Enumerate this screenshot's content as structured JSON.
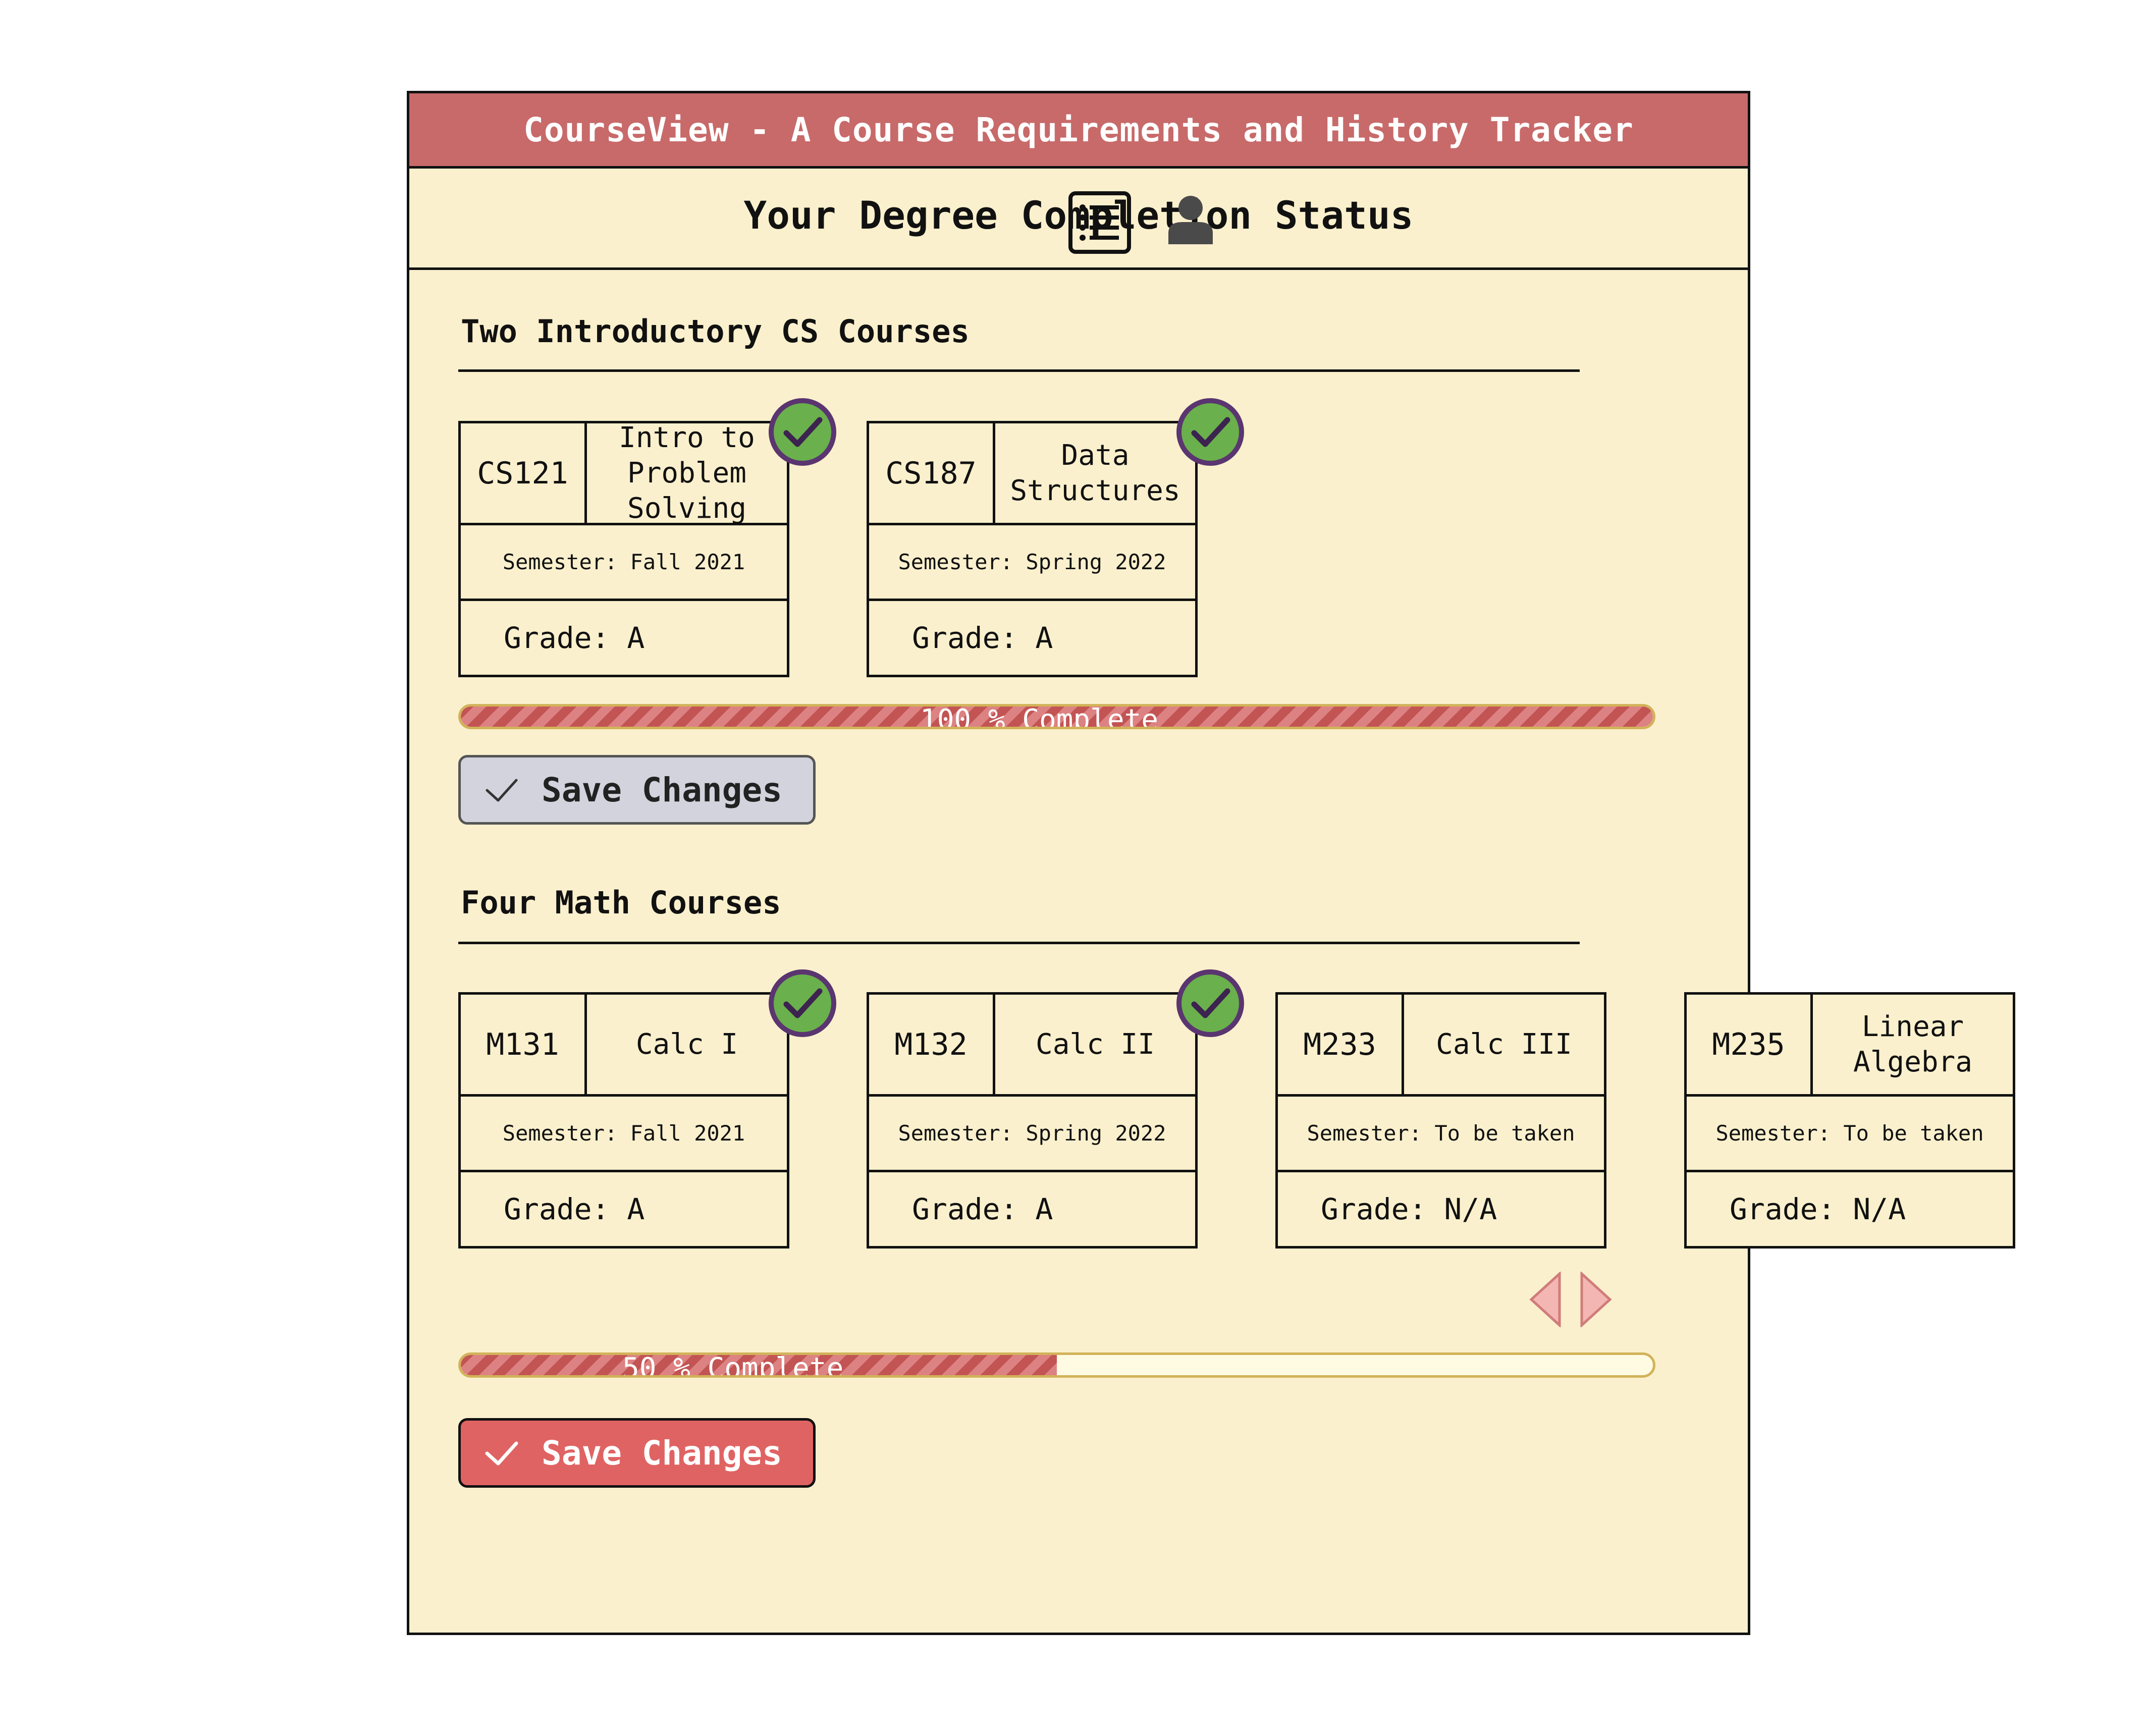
{
  "app": {
    "title": "CourseView - A Course Requirements and History Tracker"
  },
  "header": {
    "page_title": "Your Degree Completion Status"
  },
  "sections": [
    {
      "title": "Two Introductory CS Courses",
      "courses": [
        {
          "code": "CS121",
          "name": "Intro to Problem Solving",
          "semester": "Semester: Fall 2021",
          "grade": "Grade: A",
          "completed": true
        },
        {
          "code": "CS187",
          "name": "Data Structures",
          "semester": "Semester: Spring 2022",
          "grade": "Grade: A",
          "completed": true
        }
      ],
      "progress": {
        "value": 1.0,
        "label": "100 % Complete"
      },
      "save_label": "Save Changes"
    },
    {
      "title": "Four Math Courses",
      "courses": [
        {
          "code": "M131",
          "name": "Calc I",
          "semester": "Semester: Fall 2021",
          "grade": "Grade: A",
          "completed": true
        },
        {
          "code": "M132",
          "name": "Calc II",
          "semester": "Semester: Spring 2022",
          "grade": "Grade: A",
          "completed": true
        },
        {
          "code": "M233",
          "name": "Calc III",
          "semester": "Semester: To be taken",
          "grade": "Grade: N/A",
          "completed": false
        },
        {
          "code": "M235",
          "name": "Linear Algebra",
          "semester": "Semester: To be taken",
          "grade": "Grade: N/A",
          "completed": false
        }
      ],
      "progress": {
        "value": 0.5,
        "label": "50 % Complete"
      },
      "save_label": "Save Changes"
    }
  ],
  "colors": {
    "title_bar": "#c86a6a",
    "background": "#faf0cd",
    "check_green": "#6ab04c",
    "check_ring": "#5a3570",
    "progress_fill": "#c35454"
  },
  "icons": [
    "list-icon",
    "user-icon",
    "check-icon",
    "arrow-left-icon",
    "arrow-right-icon"
  ]
}
